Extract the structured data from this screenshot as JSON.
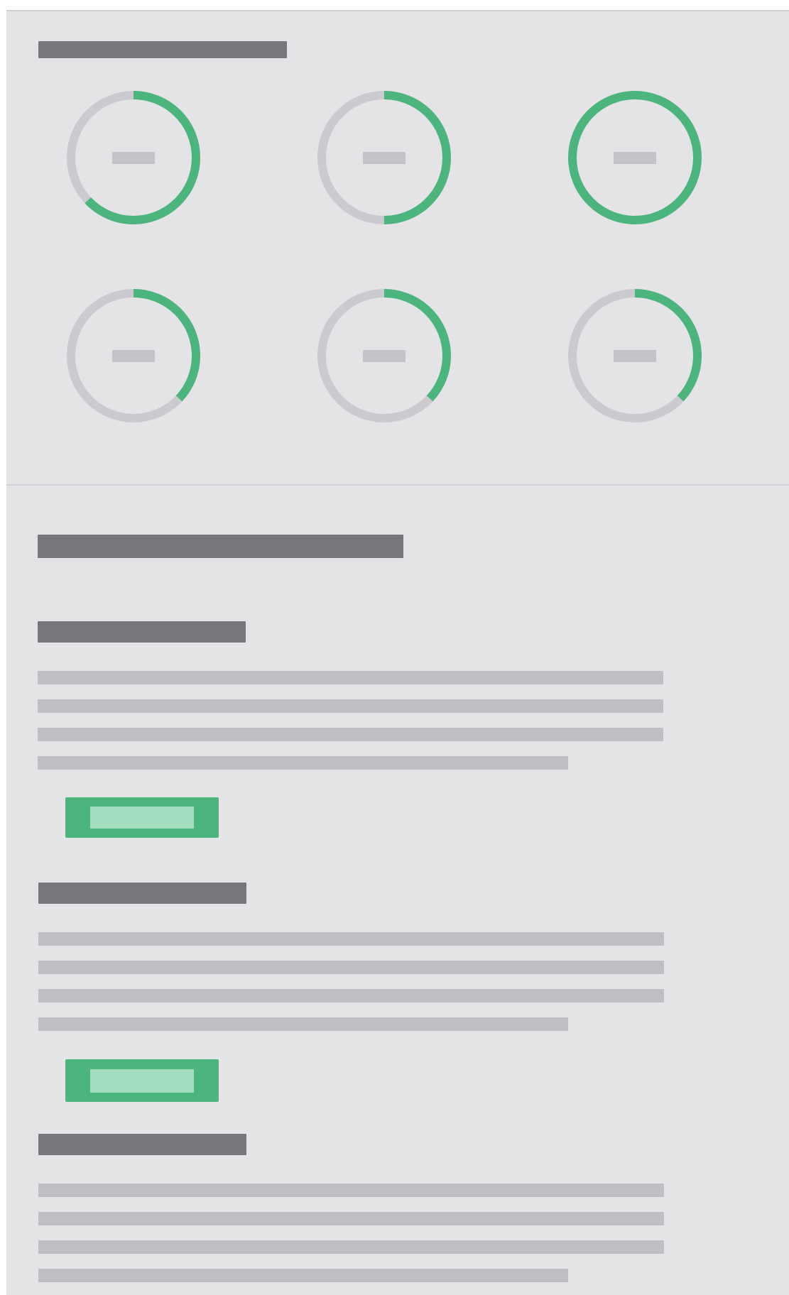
{
  "colors": {
    "background": "#e4e4e6",
    "divider": "#cfd0d3",
    "heading_placeholder": "#76777c",
    "text_placeholder": "#bebfc2",
    "gauge_track": "#cbcbcf",
    "gauge_progress": "#4cb57d",
    "button": "#4cb57d",
    "button_label_placeholder": "#a3dcbe"
  },
  "gauges": [
    {
      "progress": 0.63
    },
    {
      "progress": 0.5
    },
    {
      "progress": 1.0
    },
    {
      "progress": 0.37
    },
    {
      "progress": 0.37
    },
    {
      "progress": 0.37
    }
  ],
  "sections": [
    {
      "has_button": true
    },
    {
      "has_button": true
    },
    {
      "has_button": false
    }
  ]
}
